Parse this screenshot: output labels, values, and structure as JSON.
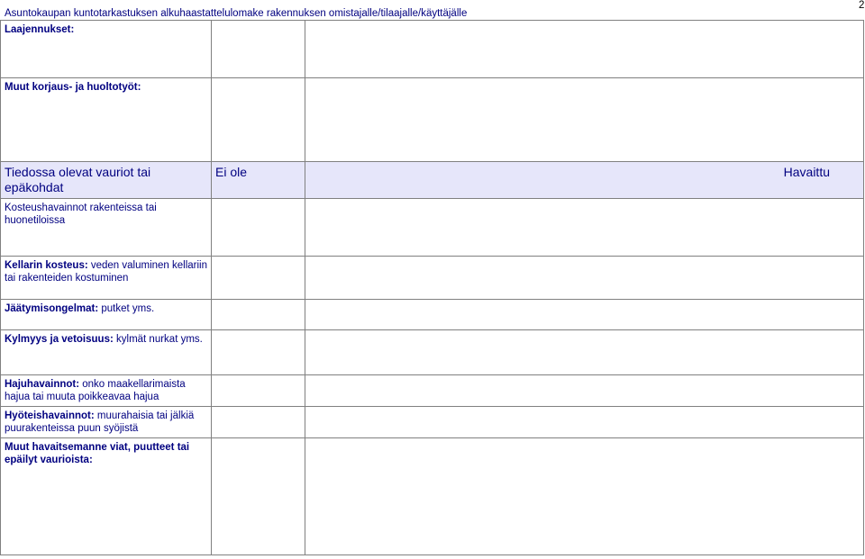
{
  "header": {
    "title": "Asuntokaupan kuntotarkastuksen alkuhaastattelulomake rakennuksen omistajalle/tilaajalle/käyttäjälle",
    "page_number": "2"
  },
  "rows": {
    "extensions": {
      "label": "Laajennukset:"
    },
    "other_repairs": {
      "label": "Muut korjaus- ja huoltotyöt:"
    },
    "known_damage": {
      "heading": "Tiedossa olevat vauriot tai epäkohdat",
      "col_not_present": "Ei ole",
      "col_observed": "Havaittu"
    },
    "moisture": {
      "desc": "Kosteushavainnot rakenteissa tai huonetiloissa"
    },
    "basement": {
      "label": "Kellarin kosteus:",
      "desc": " veden valuminen kellariin tai rakenteiden kostuminen"
    },
    "freezing": {
      "label": "Jäätymisongelmat:",
      "desc": " putket yms."
    },
    "cold": {
      "label": "Kylmyys ja vetoisuus:",
      "desc": " kylmät nurkat yms."
    },
    "odor": {
      "label": "Hajuhavainnot:",
      "desc": " onko maakellarimaista hajua tai muuta poikkeavaa hajua"
    },
    "insects": {
      "label": "Hyöteishavainnot:",
      "desc": " muurahaisia tai jälkiä puurakenteissa puun syöjistä"
    },
    "other_defects": {
      "label": "Muut havaitsemanne viat, puutteet tai epäilyt vaurioista:"
    }
  }
}
